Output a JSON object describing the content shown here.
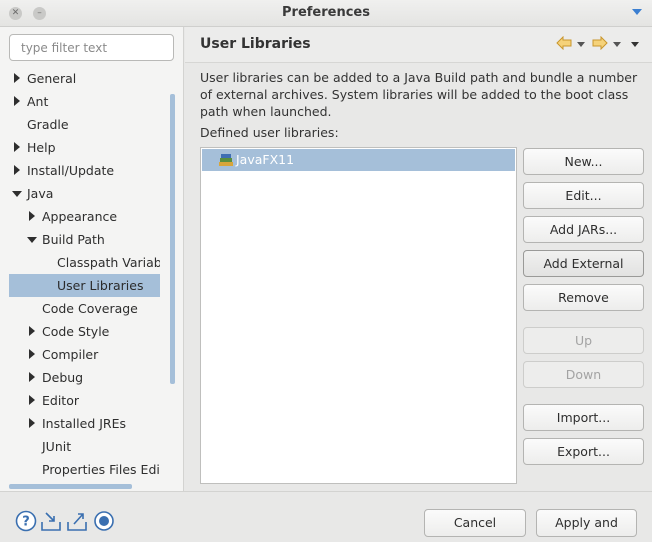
{
  "window": {
    "title": "Preferences"
  },
  "filter": {
    "placeholder": "type filter text"
  },
  "tree": [
    {
      "label": "General"
    },
    {
      "label": "Ant"
    },
    {
      "label": "Gradle"
    },
    {
      "label": "Help"
    },
    {
      "label": "Install/Update"
    },
    {
      "label": "Java"
    },
    {
      "label": "Appearance"
    },
    {
      "label": "Build Path"
    },
    {
      "label": "Classpath Variables"
    },
    {
      "label": "User Libraries"
    },
    {
      "label": "Code Coverage"
    },
    {
      "label": "Code Style"
    },
    {
      "label": "Compiler"
    },
    {
      "label": "Debug"
    },
    {
      "label": "Editor"
    },
    {
      "label": "Installed JREs"
    },
    {
      "label": "JUnit"
    },
    {
      "label": "Properties Files Editor"
    }
  ],
  "page": {
    "title": "User Libraries",
    "description": "User libraries can be added to a Java Build path and bundle a number of external archives. System libraries will be added to the boot class path when launched.",
    "defined_label": "Defined user libraries:",
    "libraries": [
      "JavaFX11"
    ]
  },
  "buttons": {
    "new": "New...",
    "edit": "Edit...",
    "add_jars": "Add JARs...",
    "add_external_jars": "Add External JARs...",
    "remove": "Remove",
    "up": "Up",
    "down": "Down",
    "import": "Import...",
    "export": "Export..."
  },
  "footer": {
    "cancel": "Cancel",
    "apply_close": "Apply and Close"
  },
  "colors": {
    "selection": "#a5bfd9",
    "accent": "#3b7fd1",
    "nav_arrow": "#e8b84a"
  }
}
